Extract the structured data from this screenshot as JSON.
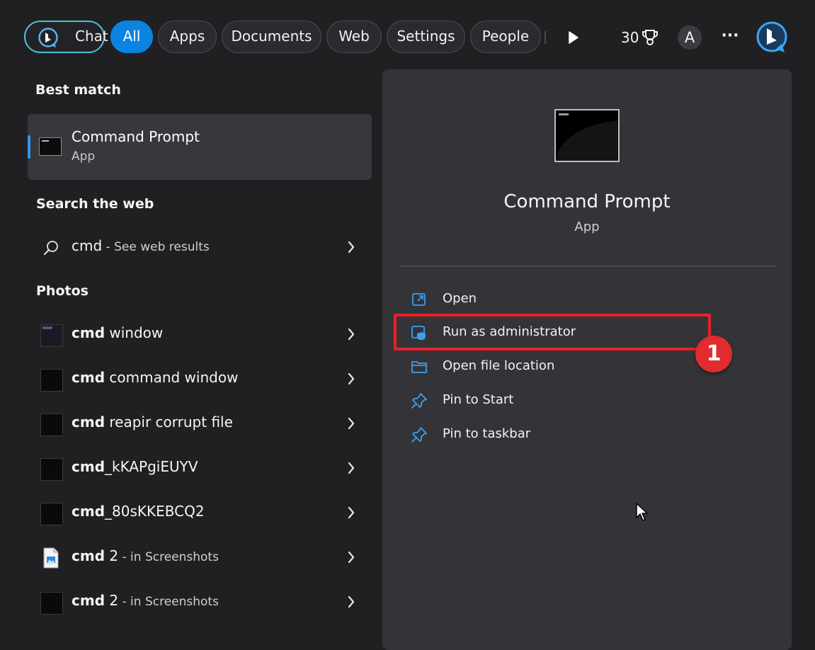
{
  "filters": {
    "chat": "Chat",
    "all": "All",
    "apps": "Apps",
    "documents": "Documents",
    "web": "Web",
    "settings": "Settings",
    "people": "People"
  },
  "header": {
    "rewards_points": "30",
    "avatar_initial": "A",
    "more_label": "···"
  },
  "best_match": {
    "heading": "Best match",
    "title": "Command Prompt",
    "subtitle": "App"
  },
  "web_search": {
    "heading": "Search the web",
    "query": "cmd",
    "suffix": " - See web results"
  },
  "photos": {
    "heading": "Photos",
    "items": [
      {
        "bold": "cmd",
        "rest": " window",
        "dim": ""
      },
      {
        "bold": "cmd",
        "rest": " command window",
        "dim": ""
      },
      {
        "bold": "cmd",
        "rest": " reapir corrupt file",
        "dim": ""
      },
      {
        "bold": "cmd",
        "rest": "_kKAPgiEUYV",
        "dim": ""
      },
      {
        "bold": "cmd",
        "rest": "_80sKKEBCQ2",
        "dim": ""
      },
      {
        "bold": "cmd",
        "rest": " 2",
        "dim": " - in Screenshots"
      },
      {
        "bold": "cmd",
        "rest": " 2",
        "dim": " - in Screenshots"
      }
    ]
  },
  "preview": {
    "title": "Command Prompt",
    "subtitle": "App"
  },
  "actions": {
    "open": "Open",
    "run_admin": "Run as administrator",
    "open_location": "Open file location",
    "pin_start": "Pin to Start",
    "pin_taskbar": "Pin to taskbar"
  },
  "annotation": {
    "step_number": "1",
    "color": "#e8202a"
  },
  "colors": {
    "accent": "#0a84e0",
    "chat_outline": "#4cc2d6",
    "background": "#202023",
    "panel": "#343438"
  }
}
